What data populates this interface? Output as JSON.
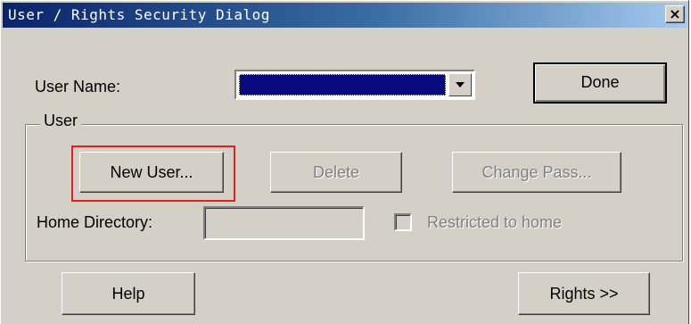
{
  "window": {
    "title": "User / Rights Security Dialog",
    "close_glyph": "×",
    "close_icon": "close-icon"
  },
  "user_name": {
    "label": "User Name:",
    "selected_value": "",
    "dropdown_icon": "chevron-down-icon"
  },
  "buttons": {
    "done": "Done",
    "help": "Help",
    "rights": "Rights >>"
  },
  "user_group": {
    "legend": "User",
    "new_user": "New User...",
    "delete": "Delete",
    "change_pass": "Change Pass...",
    "home_directory_label": "Home Directory:",
    "home_directory_value": "",
    "restricted_label": "Restricted to home",
    "restricted_checked": false
  },
  "annotation": {
    "highlight_color": "#e02020"
  }
}
